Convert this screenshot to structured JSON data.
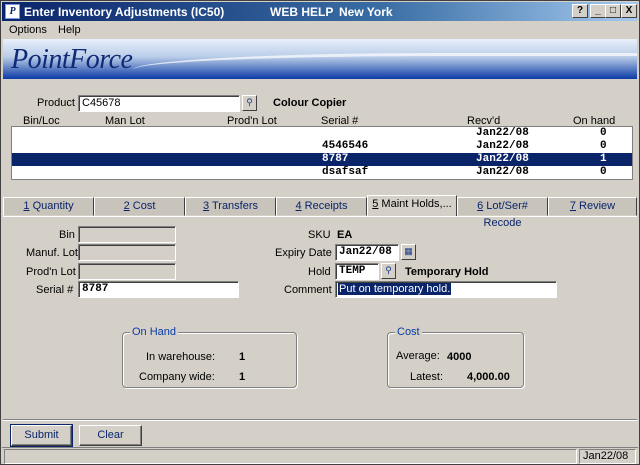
{
  "window": {
    "title": "Enter Inventory Adjustments (IC50)",
    "web_help": "WEB HELP",
    "city": "New York",
    "buttons": {
      "help": "?",
      "minimize": "_",
      "maximize": "□",
      "close": "X"
    }
  },
  "menu": {
    "options": "Options",
    "help": "Help"
  },
  "banner": {
    "logo": "PointForce"
  },
  "product": {
    "label": "Product",
    "value": "C45678",
    "description": "Colour Copier"
  },
  "grid": {
    "headers": {
      "bin": "Bin/Loc",
      "man_lot": "Man Lot",
      "prod_lot": "Prod'n Lot",
      "serial": "Serial #",
      "recvd": "Recv'd",
      "on_hand": "On hand"
    },
    "rows": [
      {
        "serial": "",
        "recvd": "Jan22/08",
        "on_hand": "0"
      },
      {
        "serial": "4546546",
        "recvd": "Jan22/08",
        "on_hand": "0"
      },
      {
        "serial": "8787",
        "recvd": "Jan22/08",
        "on_hand": "1"
      },
      {
        "serial": "dsafsaf",
        "recvd": "Jan22/08",
        "on_hand": "0"
      }
    ]
  },
  "tabs": [
    {
      "num": "1",
      "label": " Quantity"
    },
    {
      "num": "2",
      "label": " Cost"
    },
    {
      "num": "3",
      "label": " Transfers"
    },
    {
      "num": "4",
      "label": " Receipts"
    },
    {
      "num": "5",
      "label": " Maint Holds,..."
    },
    {
      "num": "6",
      "label": " Lot/Ser# Recode"
    },
    {
      "num": "7",
      "label": " Review"
    }
  ],
  "form": {
    "bin_label": "Bin",
    "manuf_lot_label": "Manuf. Lot",
    "prod_lot_label": "Prod'n Lot",
    "serial_label": "Serial #",
    "serial_value": "8787",
    "sku_label": "SKU",
    "sku_value": "EA",
    "expiry_label": "Expiry Date",
    "expiry_value": "Jan22/08",
    "hold_label": "Hold",
    "hold_value": "TEMP",
    "hold_description": "Temporary Hold",
    "comment_label": "Comment",
    "comment_value": "Put on temporary hold."
  },
  "on_hand": {
    "title": "On Hand",
    "warehouse_label": "In warehouse:",
    "warehouse_value": "1",
    "company_label": "Company wide:",
    "company_value": "1"
  },
  "cost": {
    "title": "Cost",
    "average_label": "Average:",
    "average_value": "4000",
    "latest_label": "Latest:",
    "latest_value": "4,000.00"
  },
  "buttons": {
    "submit": "Submit",
    "clear": "Clear"
  },
  "status": {
    "date": "Jan22/08"
  }
}
